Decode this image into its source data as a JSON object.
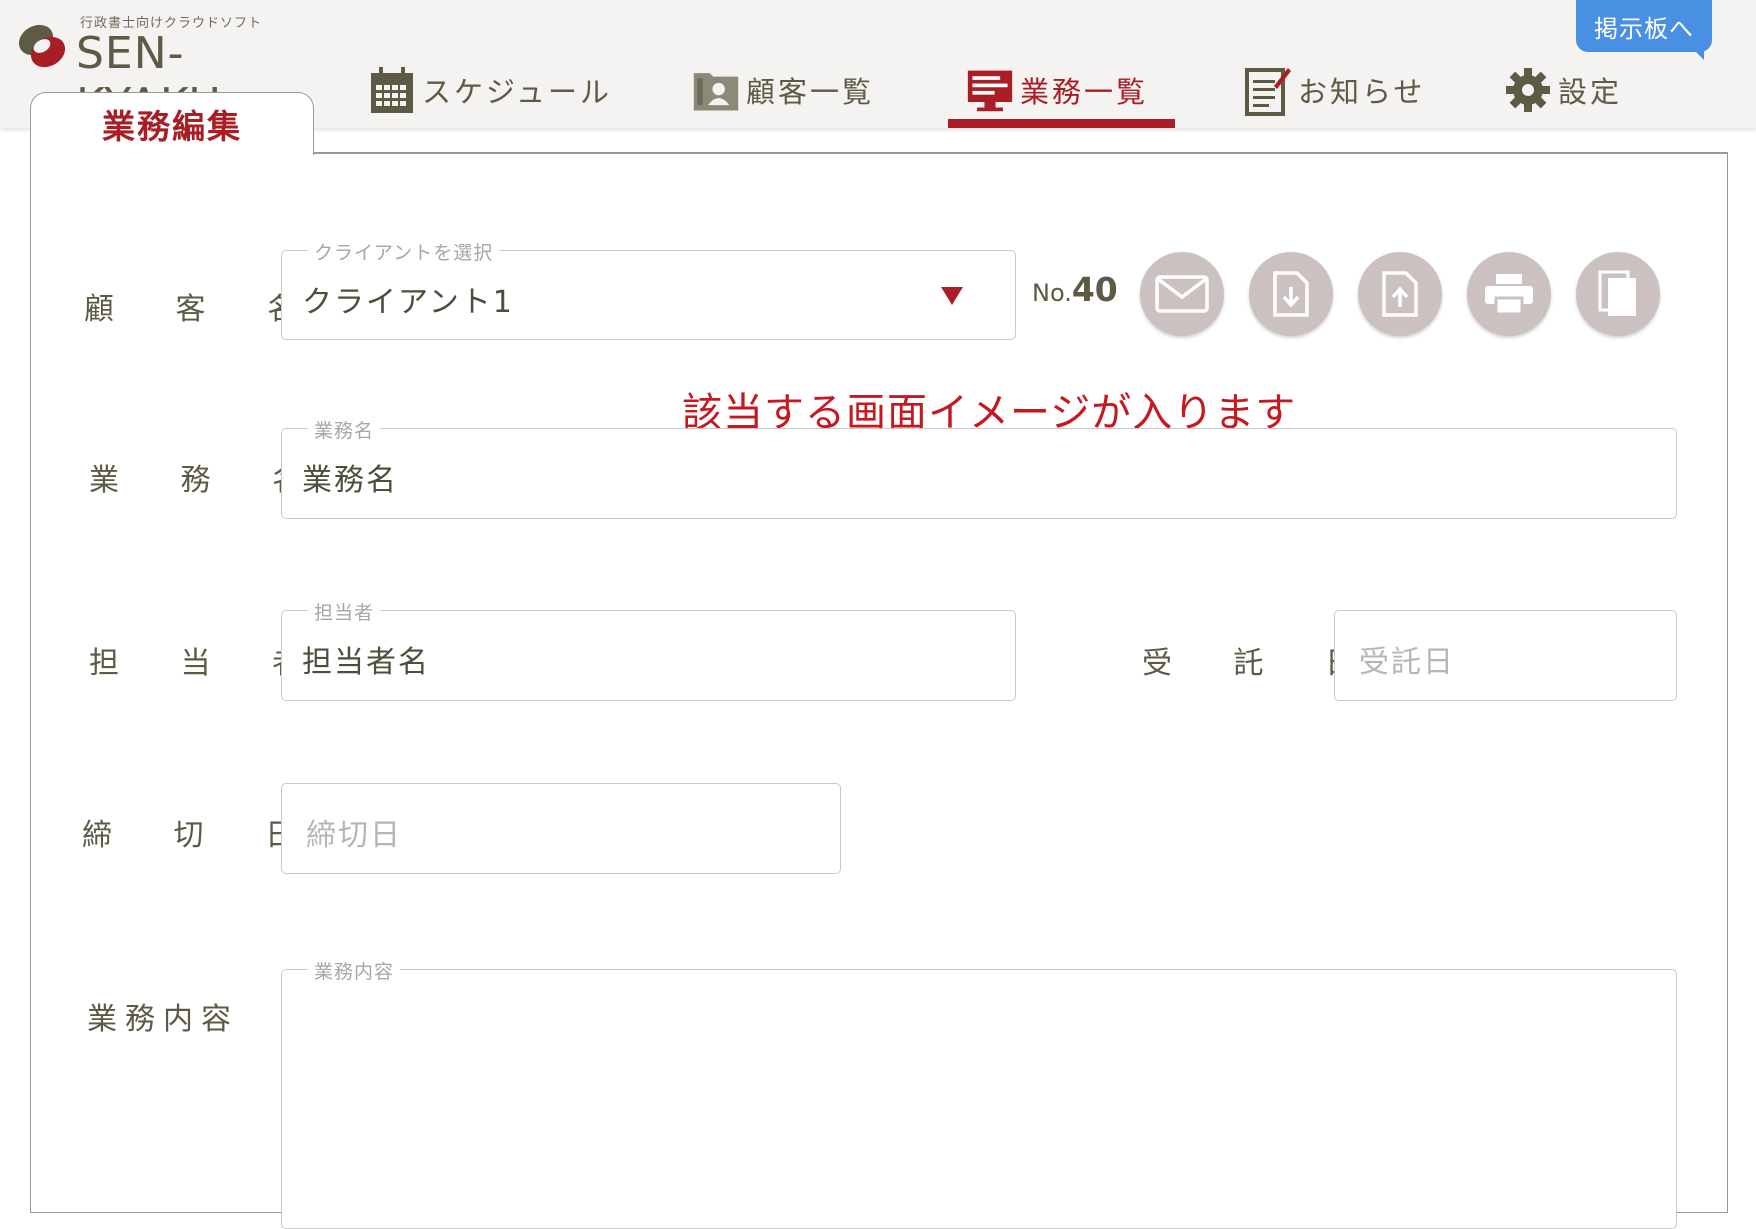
{
  "app": {
    "logo_sub": "行政書士向けクラウドソフト",
    "logo_name": "SEN-KYAKU"
  },
  "nav": {
    "items": [
      {
        "label": "スケジュール",
        "icon": "calendar-icon"
      },
      {
        "label": "顧客一覧",
        "icon": "contacts-folder-icon"
      },
      {
        "label": "業務一覧",
        "icon": "monitor-list-icon",
        "active": true
      },
      {
        "label": "お知らせ",
        "icon": "notepad-pencil-icon"
      },
      {
        "label": "設定",
        "icon": "gear-icon"
      }
    ],
    "board_button": "掲示板へ"
  },
  "panel": {
    "tab_label": "業務編集"
  },
  "form": {
    "client": {
      "label": "顧 客 名",
      "legend": "クライアントを選択",
      "value": "クライアント1"
    },
    "number": {
      "prefix": "No.",
      "value": "40"
    },
    "actions": [
      {
        "name": "mail-button",
        "icon": "envelope-icon"
      },
      {
        "name": "download-button",
        "icon": "file-download-icon"
      },
      {
        "name": "upload-button",
        "icon": "file-upload-icon"
      },
      {
        "name": "print-button",
        "icon": "printer-icon"
      },
      {
        "name": "copy-button",
        "icon": "copy-icon"
      }
    ],
    "notice": "該当する画面イメージが入ります",
    "task_name": {
      "label": "業 務 名",
      "legend": "業務名",
      "value": "業務名"
    },
    "assignee": {
      "label": "担 当 者",
      "legend": "担当者",
      "value": "担当者名"
    },
    "received_date": {
      "label": "受 託 日",
      "placeholder": "受託日"
    },
    "deadline": {
      "label": "締 切 日",
      "placeholder": "締切日"
    },
    "content": {
      "label": "業務内容",
      "legend": "業務内容"
    }
  },
  "colors": {
    "accent": "#a91d24",
    "text": "#5c5a45",
    "board_button": "#4a90e2",
    "action_circle": "#cbc1c1",
    "notice": "#c6191f"
  }
}
